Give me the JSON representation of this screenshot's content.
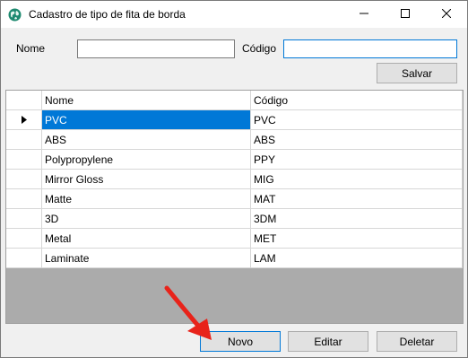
{
  "window": {
    "title": "Cadastro de tipo de fita de borda",
    "icon": "app-globe-icon",
    "minimize_icon": "minimize-icon",
    "maximize_icon": "maximize-icon",
    "close_icon": "close-icon"
  },
  "form": {
    "nome_label": "Nome",
    "nome_value": "",
    "codigo_label": "Código",
    "codigo_value": "",
    "salvar_label": "Salvar"
  },
  "grid": {
    "columns": [
      "Nome",
      "Código"
    ],
    "rows": [
      {
        "nome": "PVC",
        "codigo": "PVC"
      },
      {
        "nome": "ABS",
        "codigo": "ABS"
      },
      {
        "nome": "Polypropylene",
        "codigo": "PPY"
      },
      {
        "nome": "Mirror Gloss",
        "codigo": "MIG"
      },
      {
        "nome": "Matte",
        "codigo": "MAT"
      },
      {
        "nome": "3D",
        "codigo": "3DM"
      },
      {
        "nome": "Metal",
        "codigo": "MET"
      },
      {
        "nome": "Laminate",
        "codigo": "LAM"
      }
    ],
    "selected_row": 0,
    "current_row_indicator": "row-pointer-icon"
  },
  "actions": {
    "novo_label": "Novo",
    "editar_label": "Editar",
    "deletar_label": "Deletar"
  },
  "annotation": {
    "icon": "red-arrow-icon",
    "color": "#e8231a"
  },
  "colors": {
    "selection": "#0078d7",
    "grid_background": "#ababab",
    "window_background": "#f0f0f0"
  }
}
